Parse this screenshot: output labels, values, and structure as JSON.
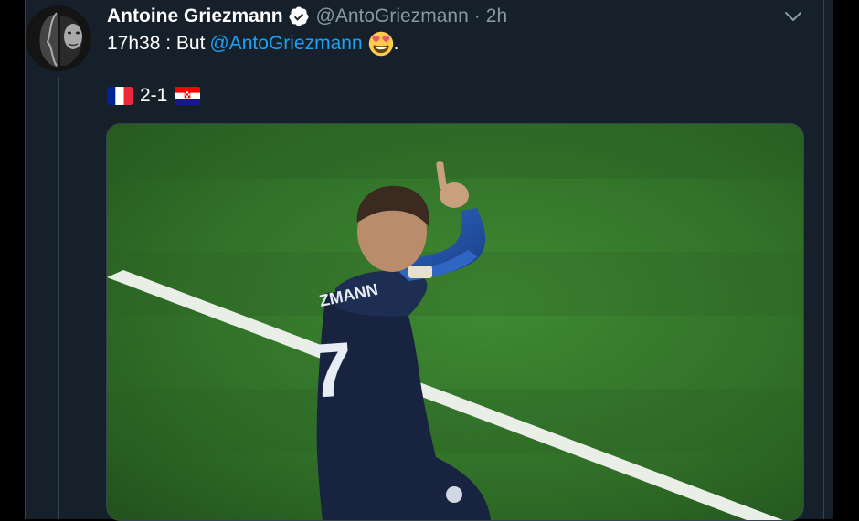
{
  "tweet": {
    "author_name": "Antoine Griezmann",
    "handle": "@AntoGriezmann",
    "separator": "·",
    "time": "2h",
    "text_prefix": "17h38 : But",
    "mention": "@AntoGriezmann",
    "text_suffix": ".",
    "score": "2-1",
    "media_jersey_name": "ZMANN",
    "media_jersey_number": "7"
  },
  "colors": {
    "background": "#15202b",
    "text": "#ffffff",
    "secondary": "#8899a6",
    "link": "#1da1f2",
    "border": "#38444d"
  },
  "icons": {
    "verified": "verified-badge-icon",
    "caret": "chevron-down-icon",
    "emoji": "heart-eyes-emoji",
    "flag_left": "france-flag",
    "flag_right": "croatia-flag"
  }
}
